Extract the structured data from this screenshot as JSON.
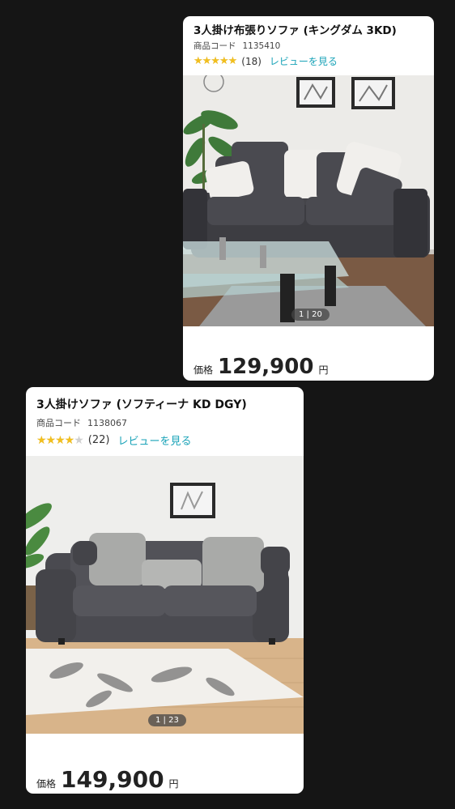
{
  "products": [
    {
      "title": "3人掛け布張りソファ (キングダム 3KD)",
      "code_label": "商品コード",
      "code": "1135410",
      "rating": 5,
      "stars_text": "★★★★★",
      "review_count": "(18)",
      "review_link": "レビューを見る",
      "image_pager": "1 | 20",
      "image_alt": "dark grey fabric sofa with white and grey cushions, glass coffee table, plant",
      "price_label": "価格",
      "price": "129,900",
      "currency": "円"
    },
    {
      "title": "3人掛けソファ (ソフティーナ KD DGY)",
      "code_label": "商品コード",
      "code": "1138067",
      "rating": 4,
      "stars_text": "★★★★★",
      "review_count": "(22)",
      "review_link": "レビューを見る",
      "image_pager": "1 | 23",
      "image_alt": "dark grey sofa with light grey cushions on leaf-pattern rug",
      "price_label": "価格",
      "price": "149,900",
      "currency": "円"
    }
  ],
  "colors": {
    "background": "#151515",
    "star": "#f2bf1e",
    "link": "#1aa3b8",
    "sofa1": "#3d3d42",
    "sofa2": "#4a4a50"
  }
}
